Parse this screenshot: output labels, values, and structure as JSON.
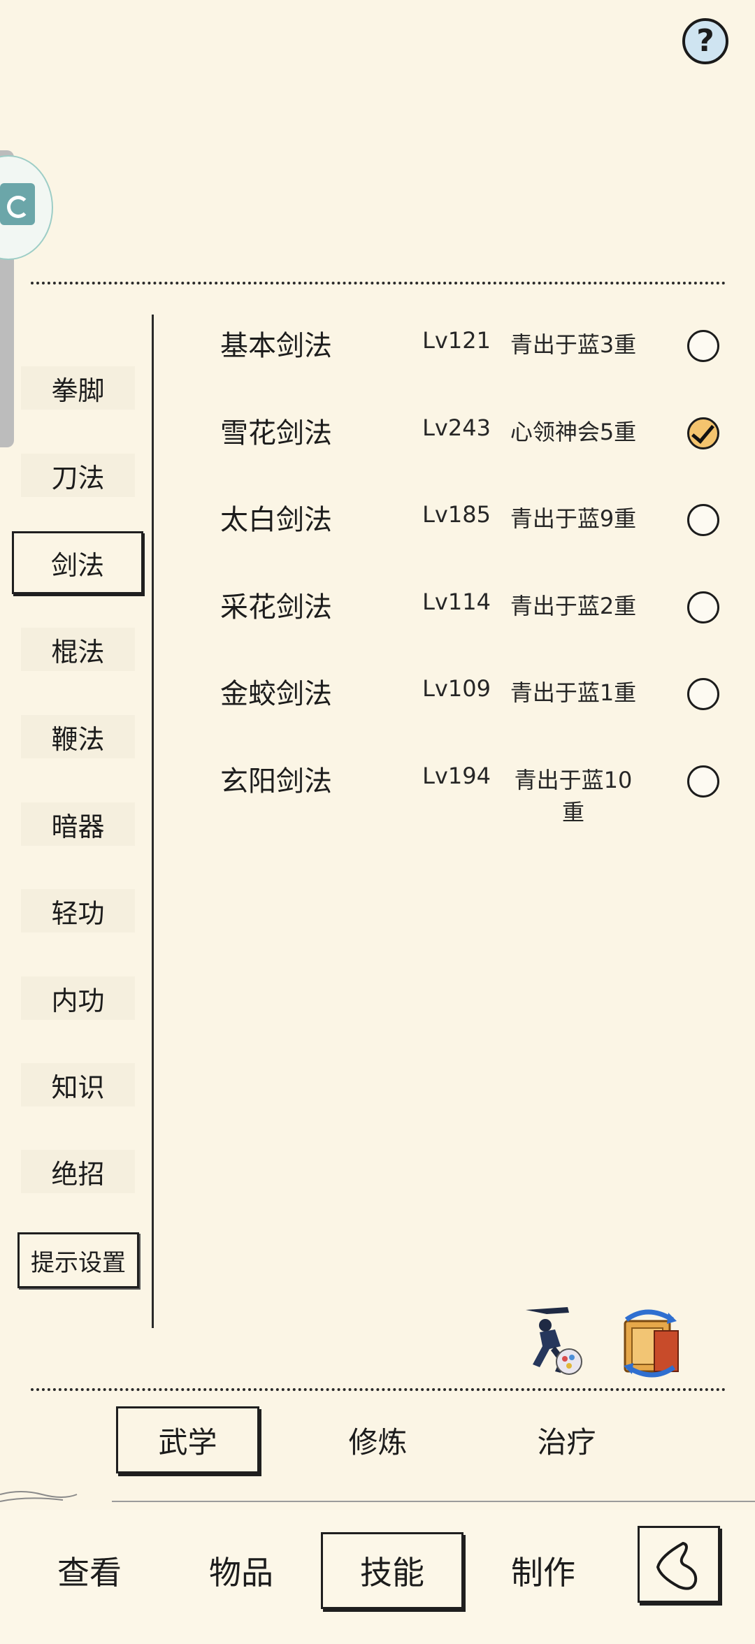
{
  "header": {
    "help_label": "?"
  },
  "categories": [
    "拳脚",
    "刀法",
    "剑法",
    "棍法",
    "鞭法",
    "暗器",
    "轻功",
    "内功",
    "知识",
    "绝招"
  ],
  "selected_category": "剑法",
  "hint_settings_label": "提示设置",
  "skills": [
    {
      "name": "基本剑法",
      "level": "Lv121",
      "stage": "青出于蓝3重",
      "equipped": false
    },
    {
      "name": "雪花剑法",
      "level": "Lv243",
      "stage": "心领神会5重",
      "equipped": true
    },
    {
      "name": "太白剑法",
      "level": "Lv185",
      "stage": "青出于蓝9重",
      "equipped": false
    },
    {
      "name": "采花剑法",
      "level": "Lv114",
      "stage": "青出于蓝2重",
      "equipped": false
    },
    {
      "name": "金蛟剑法",
      "level": "Lv109",
      "stage": "青出于蓝1重",
      "equipped": false
    },
    {
      "name": "玄阳剑法",
      "level": "Lv194",
      "stage": "青出于蓝10重",
      "equipped": false
    }
  ],
  "sub_tabs": [
    "武学",
    "修炼",
    "治疗"
  ],
  "selected_sub_tab": "武学",
  "nav": [
    "查看",
    "物品",
    "技能",
    "制作"
  ],
  "selected_nav": "技能",
  "colors": {
    "background": "#fbf5e5",
    "checked": "#f4c46e",
    "help_bg": "#cfe4f1"
  }
}
